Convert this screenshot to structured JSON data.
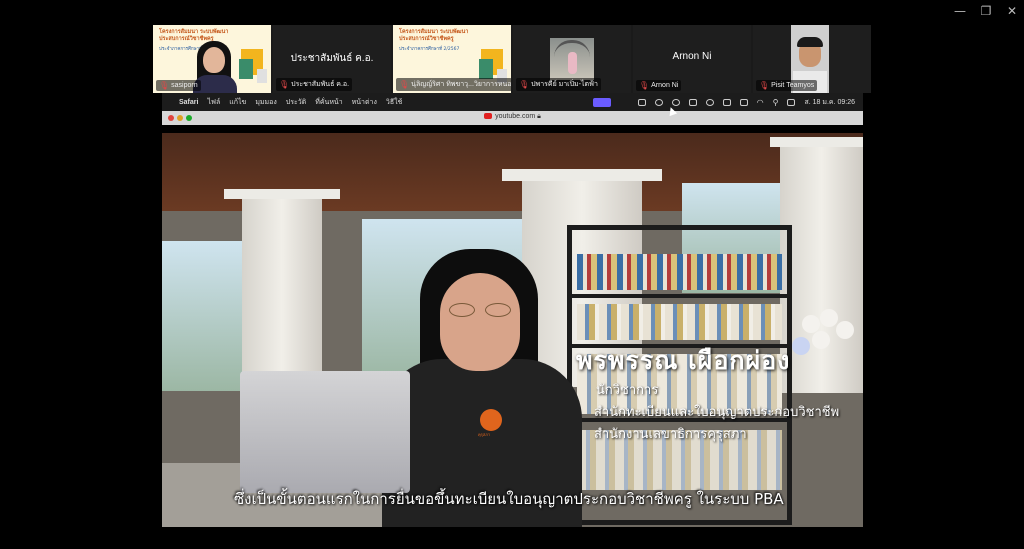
{
  "window": {
    "minimize": "—",
    "restore": "❐",
    "close": "✕"
  },
  "participants": [
    {
      "name": "sasiporn",
      "type": "video",
      "slide_title": "โครงการสัมมนา ระบบพัฒนาประสบการณ์วิชาชีพครู",
      "slide_sub": "ประจำภาคการศึกษาที่",
      "active": true
    },
    {
      "name": "ประชาสัมพันธ์ ค.อ.",
      "type": "name"
    },
    {
      "name": "นุ่ลิญญ์ริศา ทิพขาวุ...วิยาการหนองคาย(ป...",
      "type": "slide",
      "slide_title": "โครงการสัมมนา ระบบพัฒนาประสบการณ์วิชาชีพครู",
      "slide_sub": "ประจำภาคการศึกษาที่ 2/2567"
    },
    {
      "name": "ปพารคีย์ มาเปิ่ม-ไตฟ้า",
      "type": "photo"
    },
    {
      "name": "Arnon Ni",
      "type": "name"
    },
    {
      "name": "Pisit Teamyos",
      "type": "video2"
    }
  ],
  "menubar": {
    "app": "Safari",
    "items": [
      "ไฟล์",
      "แก้ไข",
      "มุมมอง",
      "ประวัติ",
      "ที่คั่นหน้า",
      "หน้าต่าง",
      "วิธีใช้"
    ],
    "clock": "ส. 18 ม.ค.  09:26"
  },
  "safari": {
    "url": "youtube.com"
  },
  "video": {
    "speaker_name": "พรพรรณ เผือกผ่อง",
    "speaker_title": "นักวิชาการ",
    "speaker_dept": "สำนักทะเบียนและใบอนุญาตประกอบวิชาชีพ",
    "speaker_org": "สำนักงานเลขาธิการคุรุสภา",
    "subtitle": "ซึ่งเป็นขั้นตอนแรกในการยื่นขอขึ้นทะเบียนใบอนุญาตประกอบวิชาชีพครู ในระบบ PBA",
    "shirt_logo": "คุรุสภา"
  },
  "colors": {
    "active_border": "#5ad47a",
    "mic_off": "#e04848",
    "slide_orange": "#c65a1e"
  }
}
